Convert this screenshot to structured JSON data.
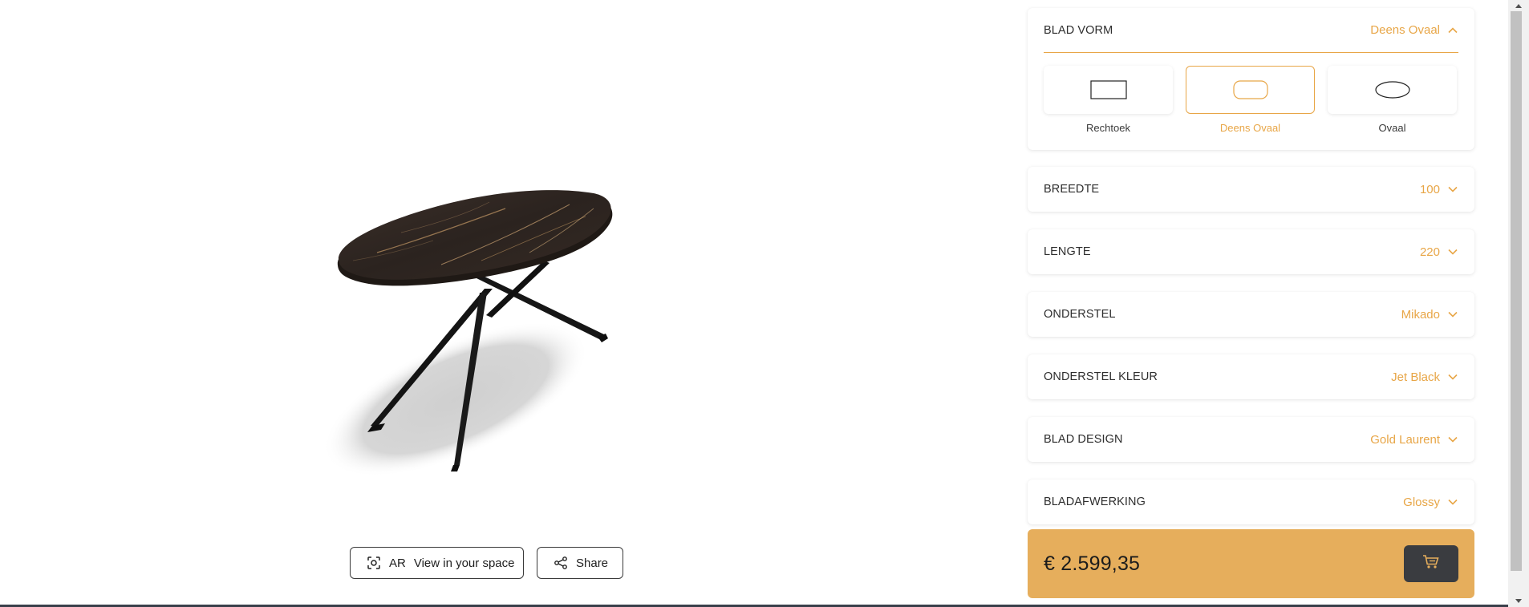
{
  "viewer": {
    "ar_label": "AR",
    "ar_text": "View in your space",
    "share_label": "Share"
  },
  "config": {
    "blad_vorm": {
      "title": "BLAD VORM",
      "value": "Deens Ovaal",
      "options": [
        {
          "label": "Rechtoek",
          "shape": "rectangle",
          "selected": false
        },
        {
          "label": "Deens Ovaal",
          "shape": "rounded-rectangle",
          "selected": true
        },
        {
          "label": "Ovaal",
          "shape": "oval",
          "selected": false
        }
      ]
    },
    "breedte": {
      "title": "BREEDTE",
      "value": "100"
    },
    "lengte": {
      "title": "LENGTE",
      "value": "220"
    },
    "onderstel": {
      "title": "ONDERSTEL",
      "value": "Mikado"
    },
    "onderstel_kleur": {
      "title": "ONDERSTEL KLEUR",
      "value": "Jet Black"
    },
    "blad_design": {
      "title": "BLAD DESIGN",
      "value": "Gold Laurent"
    },
    "bladafwerking": {
      "title": "BLADAFWERKING",
      "value": "Glossy"
    }
  },
  "price": {
    "value": "€ 2.599,35"
  },
  "icons": {
    "ar": "ar-scan-icon",
    "share": "share-icon",
    "expand": "chevron-down-icon",
    "collapse": "chevron-up-icon",
    "cart": "cart-icon"
  },
  "colors": {
    "accent": "#e8a647",
    "price_bar": "#e6ae5c",
    "cart_button": "#3a3c40"
  }
}
